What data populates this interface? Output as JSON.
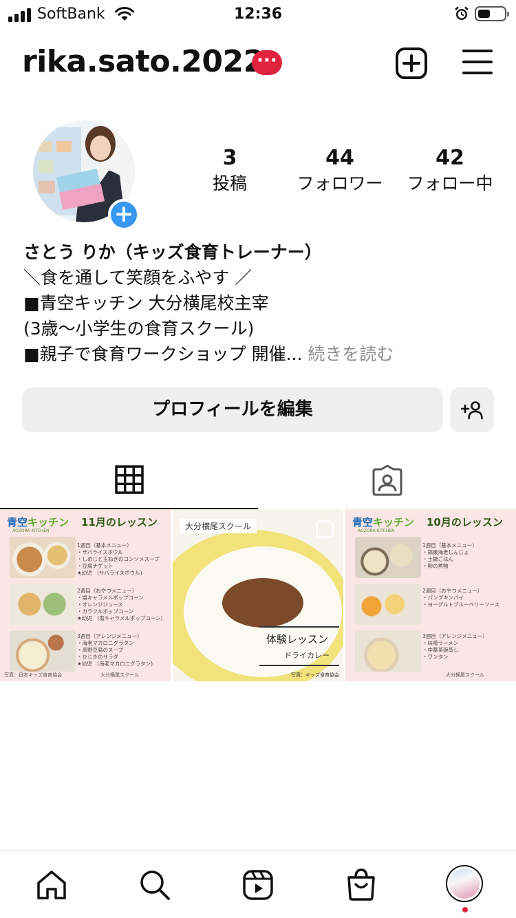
{
  "status_bar": {
    "carrier": "SoftBank",
    "time": "12:36"
  },
  "header": {
    "username": "rika.sato.2022",
    "notification_badge": "···"
  },
  "profile": {
    "stats": [
      {
        "value": "3",
        "label": "投稿"
      },
      {
        "value": "44",
        "label": "フォロワー"
      },
      {
        "value": "42",
        "label": "フォロー中"
      }
    ],
    "display_name": "さとう りか（キッズ食育トレーナー）",
    "bio_lines": [
      "＼食を通して笑顔をふやす ／",
      "■青空キッチン 大分横尾校主宰",
      "(3歳〜小学生の食育スクール)",
      "■親子で食育ワークショップ 開催..."
    ],
    "more_label": "続きを読む",
    "edit_button": "プロフィールを編集"
  },
  "posts": [
    {
      "brand": "青空",
      "brand_accent": "キッチン",
      "brand_sub": "AOZORA KITCHEN",
      "title": "11月のレッスン",
      "menus": [
        "1週目（基本メニュー）\n・サバライスボウル\n・しめじと玉ねぎのコンソメスープ\n・豆腐ナゲット\n★幼児　(サバライスボウル)",
        "2週目（おやつメニュー）\n・塩キャラメルポップコーン\n・オレンジジュース\n・カラフルポップコーン\n★幼児　(塩キャラメルポップコーン)",
        "3週目（アレンジメニュー）\n・海老マカロニグラタン\n・高野豆腐のスープ\n・ひじきのサラダ\n★幼児　(海老マカロニグラタン)"
      ],
      "credit": "写真：日本キッズ食育協会",
      "school": "大分横尾スクール"
    },
    {
      "tag": "大分横尾スクール",
      "title": "体験レッスン",
      "subtitle": "ドライカレー",
      "credit": "写真：キッズ食育協会"
    },
    {
      "brand": "青空",
      "brand_accent": "キッチン",
      "brand_sub": "AOZORA KITCHEN",
      "title": "10月のレッスン",
      "menus": [
        "1週目（基本メニュー）\n・鶏策海老しんじょ\n・土鍋ごはん\n・卵の煮物",
        "2週目（おやつメニュー）\n・パンプキンパイ\n・ヨーグルトブルーベリーソース",
        "3週目（アレンジメニュー）\n・味噌ラーメン\n・中華茶碗蒸し\n・ワンタン"
      ],
      "school": "大分横尾スクール"
    }
  ],
  "colors": {
    "accent": "#3797f0",
    "badge": "#e0243f",
    "button_bg": "#efefef",
    "muted_text": "#8e8e8e"
  },
  "icons": {
    "header": [
      "plus-square-icon",
      "hamburger-menu-icon"
    ],
    "tabs": [
      "grid-icon",
      "tagged-person-icon"
    ],
    "nav": [
      "home-icon",
      "search-icon",
      "reels-icon",
      "shop-icon",
      "profile-avatar"
    ]
  }
}
